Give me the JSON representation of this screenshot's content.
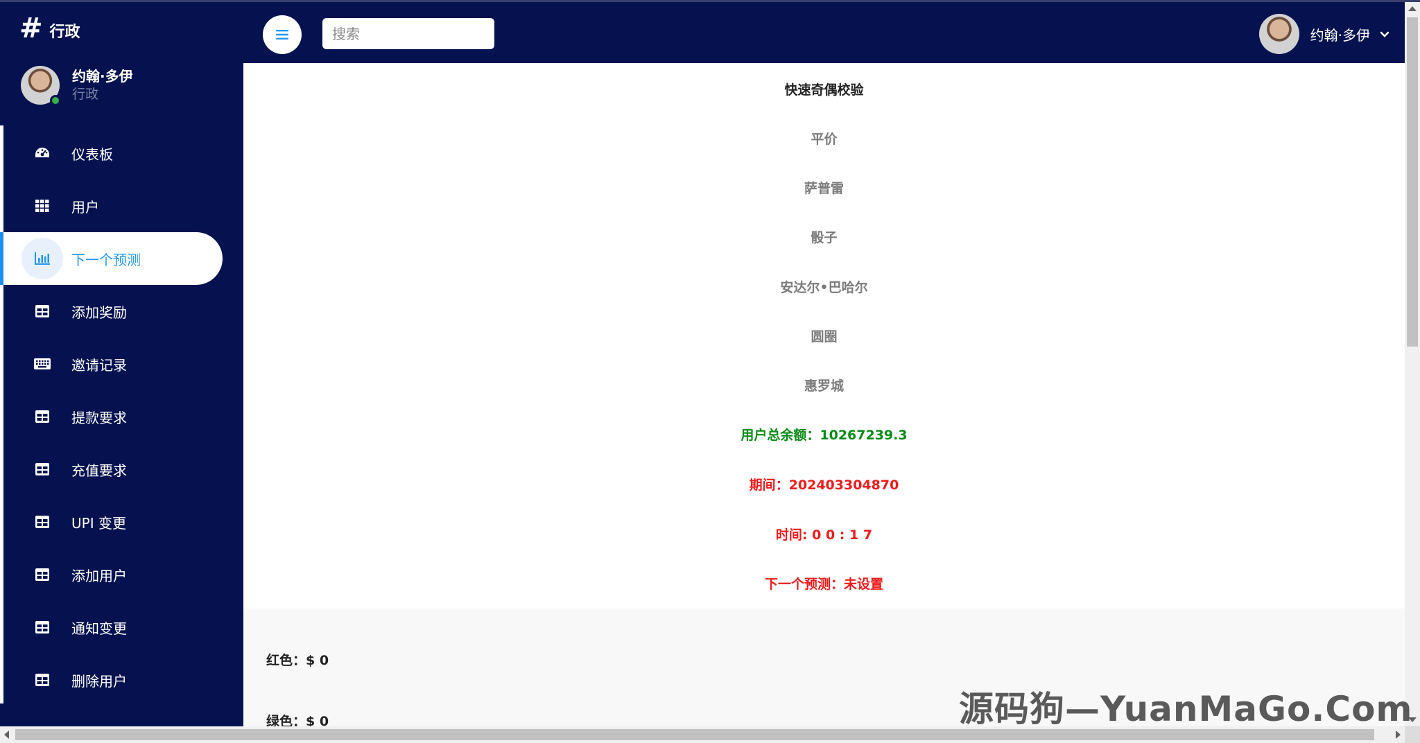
{
  "brand": {
    "title": "行政"
  },
  "profile": {
    "name": "约翰·多伊",
    "role": "行政"
  },
  "menu": [
    {
      "label": "仪表板",
      "icon": "dashboard-icon"
    },
    {
      "label": "用户",
      "icon": "grid-icon"
    },
    {
      "label": "下一个预测",
      "icon": "bar-chart-icon",
      "active": true
    },
    {
      "label": "添加奖励",
      "icon": "table-icon"
    },
    {
      "label": "邀请记录",
      "icon": "keyboard-icon"
    },
    {
      "label": "提款要求",
      "icon": "table-icon"
    },
    {
      "label": "充值要求",
      "icon": "table-icon"
    },
    {
      "label": "UPI 变更",
      "icon": "table-icon"
    },
    {
      "label": "添加用户",
      "icon": "table-icon"
    },
    {
      "label": "通知变更",
      "icon": "table-icon"
    },
    {
      "label": "删除用户",
      "icon": "table-icon"
    }
  ],
  "topbar": {
    "search_placeholder": "搜索",
    "user_name": "约翰·多伊"
  },
  "main": {
    "title": "快速奇偶校验",
    "games": [
      "平价",
      "萨普雷",
      "骰子",
      "安达尔•巴哈尔",
      "圆圈",
      "惠罗城"
    ],
    "balance": "用户总余额：10267239.3",
    "period": "期间：202403304870",
    "time": "时间: 0 0 : 1 7",
    "next_prediction": "下一个预测：未设置"
  },
  "bets": {
    "red": "红色：$ 0",
    "green": "绿色：$ 0"
  },
  "watermark": "源码狗—YuanMaGo.Com",
  "colors": {
    "sidebar": "#06124f",
    "accent": "#2196f3",
    "balance": "#0a8a16",
    "alert": "#ec1b1b"
  }
}
